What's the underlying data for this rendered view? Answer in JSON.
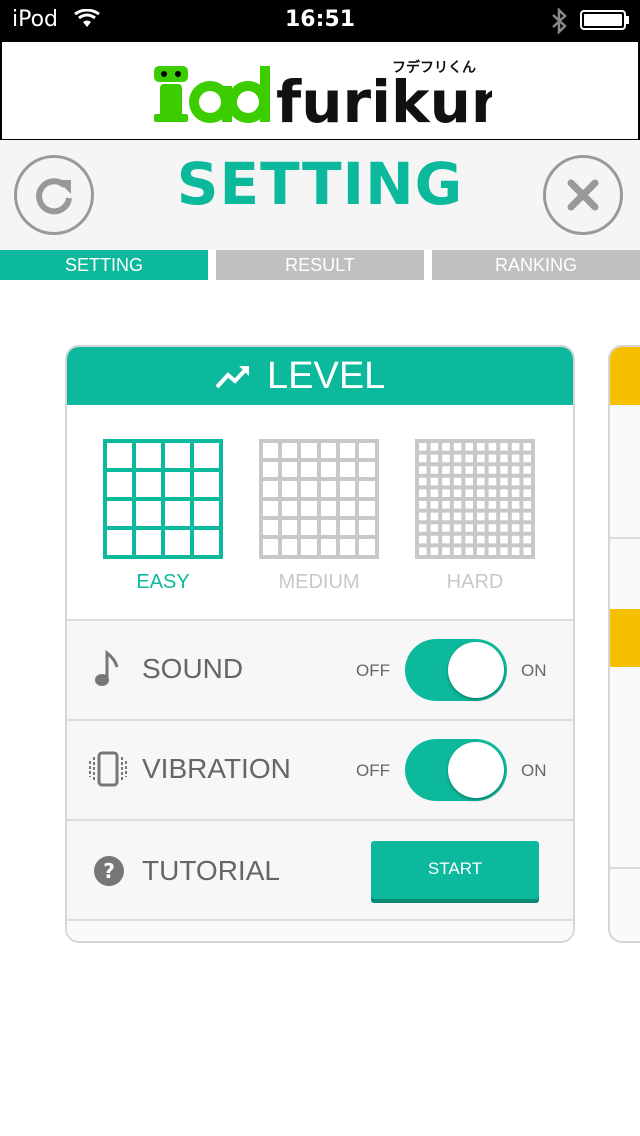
{
  "status_bar": {
    "carrier": "iPod",
    "time": "16:51"
  },
  "banner": {
    "logo_alt": "padfurikun",
    "logo_kana": "フデフリくん"
  },
  "header": {
    "title": "SETTING"
  },
  "tabs": [
    {
      "label": "SETTING",
      "active": true
    },
    {
      "label": "RESULT",
      "active": false
    },
    {
      "label": "RANKING",
      "active": false
    }
  ],
  "level": {
    "title": "LEVEL",
    "options": [
      {
        "label": "EASY",
        "selected": true
      },
      {
        "label": "MEDIUM",
        "selected": false
      },
      {
        "label": "HARD",
        "selected": false
      }
    ]
  },
  "settings": {
    "sound": {
      "label": "SOUND",
      "off": "OFF",
      "on": "ON",
      "state": "on"
    },
    "vibration": {
      "label": "VIBRATION",
      "off": "OFF",
      "on": "ON",
      "state": "on"
    },
    "tutorial": {
      "label": "TUTORIAL",
      "button": "START"
    }
  },
  "colors": {
    "accent": "#0db99c",
    "inactive_tab": "#c0c0c0",
    "peek_header": "#f5c000"
  }
}
